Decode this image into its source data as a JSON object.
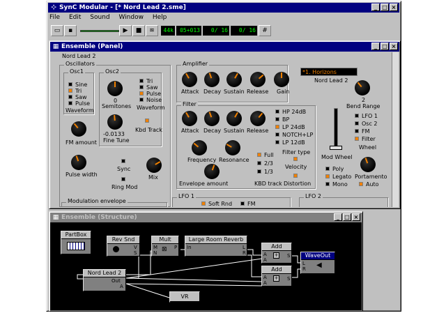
{
  "app": {
    "title": "SynC Modular - [* Nord Lead 2.sme]"
  },
  "menu": [
    "File",
    "Edit",
    "Sound",
    "Window",
    "Help"
  ],
  "toolbar": {
    "tempo": "44k",
    "time": "05+013",
    "c1": "0/ 16",
    "c2": "0/ 16"
  },
  "panel": {
    "title": "Ensemble (Panel)",
    "synth_name": "Nord Lead 2",
    "osc": {
      "title": "Oscillators",
      "osc1": "Osc1",
      "osc1_opts": [
        "Sine",
        "Tri",
        "Saw",
        "Pulse"
      ],
      "osc1_on": 1,
      "waveform": "Waveform",
      "osc2": "Osc2",
      "semitones": "Semitones",
      "semi_val": "0",
      "finetune_val": "-0.0133",
      "finetune": "Fine Tune",
      "osc2_opts": [
        "Tri",
        "Saw",
        "Pulse",
        "Noise"
      ],
      "osc2_on": 2,
      "waveform2": "Waveform",
      "kbd": "Kbd Track",
      "fm": "FM amount",
      "pw": "Pulse width",
      "sync": "Sync",
      "ringmod": "Ring Mod",
      "mix": "Mix",
      "modenv": "Modulation envelope"
    },
    "amp": {
      "title": "Amplifier",
      "knobs": [
        "Attack",
        "Decay",
        "Sustain",
        "Release",
        "Gain"
      ]
    },
    "preset": "*1. Horizons",
    "preset_name": "Nord Lead 2",
    "bend": {
      "val": "2",
      "label": "Bend Range"
    },
    "lfo": {
      "opts": [
        "LFO 1",
        "Osc 2",
        "FM",
        "Filter"
      ],
      "on": 3,
      "label": "Wheel"
    },
    "modwheel": "Mod Wheel",
    "filter": {
      "title": "Filter",
      "knobs": [
        "Attack",
        "Decay",
        "Sustain",
        "Release"
      ],
      "types": [
        "HP 24dB",
        "BP",
        "LP 24dB",
        "NOTCH+LP",
        "LP 12dB"
      ],
      "type_on": 2,
      "type_label": "Filter type",
      "freq": "Frequency",
      "res": "Resonance",
      "env": "Envelope amount",
      "kbd": [
        "Full",
        "2/3",
        "1/3"
      ],
      "kbd_label": "KBD track",
      "velocity": "Velocity",
      "distortion": "Distortion"
    },
    "voice": {
      "opts": [
        "Poly",
        "Legato",
        "Mono"
      ],
      "on": 1,
      "portamento": "Portamento",
      "auto": "Auto"
    },
    "lfo1": "LFO 1",
    "softrnd": "Soft Rnd",
    "fm": "FM",
    "lfo2": "LFO 2"
  },
  "structure": {
    "title": "Ensemble (Structure)",
    "partbox": "PartBox",
    "revsnd": "Rev Snd",
    "mult": "Mult",
    "reverb": "Large Room Reverb",
    "add": "Add",
    "waveout": "WaveOut",
    "nordlead": "Nord Lead 2",
    "vr": "VR",
    "ports": {
      "v": "V",
      "s": "S",
      "m": "M",
      "n": "N",
      "p": "P",
      "in": "In",
      "l": "L",
      "r": "R",
      "a": "A",
      "out": "Out",
      "aout": "A"
    }
  },
  "colors": {
    "title_active": "#000080",
    "title_inactive": "#808080",
    "face": "#c0c0c0",
    "accent": "#f08000"
  }
}
